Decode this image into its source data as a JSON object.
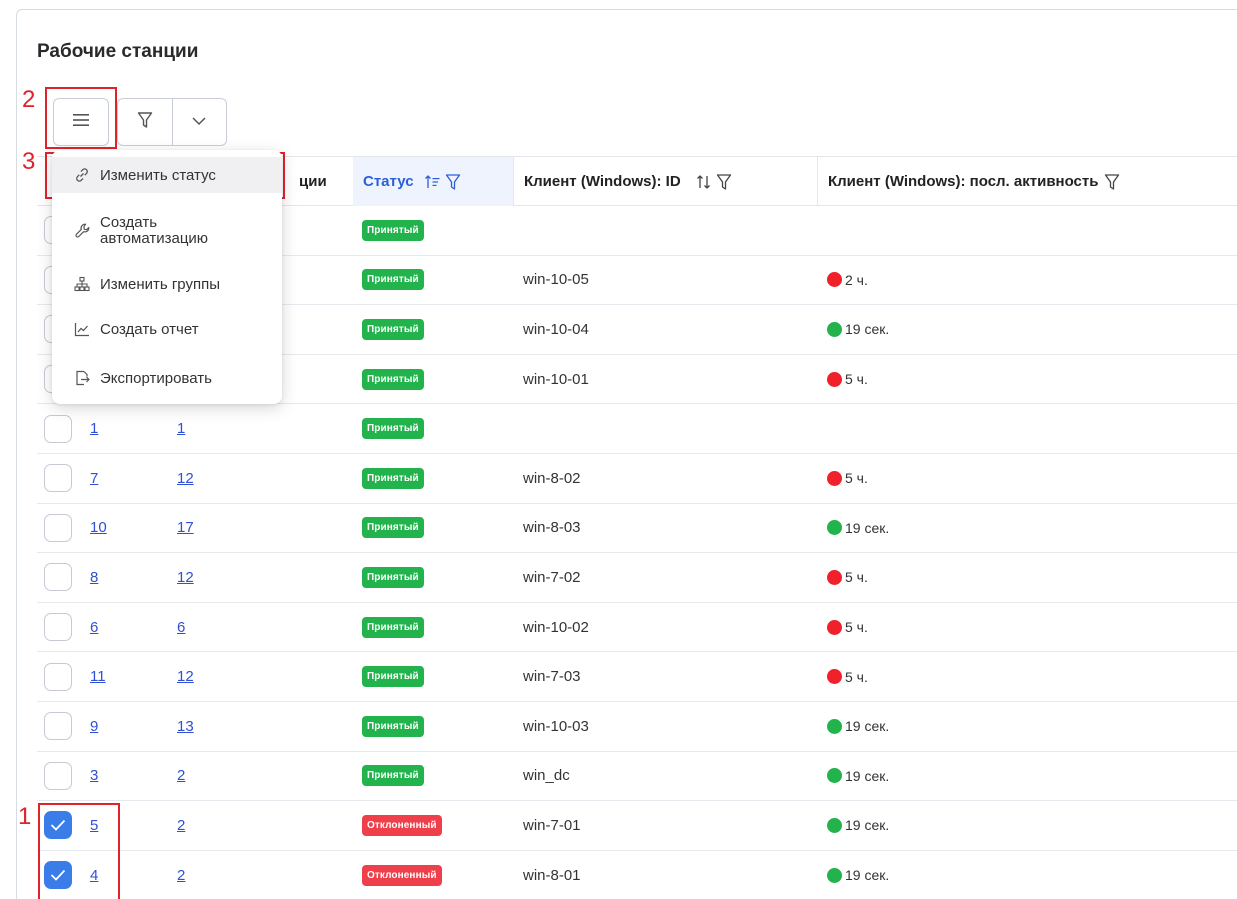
{
  "page": {
    "title": "Рабочие станции"
  },
  "toolbar": {
    "menu_icon": "hamburger-icon",
    "filter_icon": "funnel-icon",
    "dropdown_icon": "chevron-down-icon"
  },
  "columns": {
    "hidden_partial": "ции",
    "status": "Статус",
    "client_id": "Клиент (Windows): ID",
    "client_activity": "Клиент (Windows): посл. активность"
  },
  "menu": {
    "items": [
      {
        "label": "Изменить статус",
        "icon": "link-icon"
      },
      {
        "label": "Создать автоматизацию",
        "line1": "Создать",
        "line2": "автоматизацию",
        "icon": "wrench-icon"
      },
      {
        "label": "Изменить группы",
        "icon": "hierarchy-icon"
      },
      {
        "label": "Создать отчет",
        "icon": "chart-icon"
      },
      {
        "label": "Экспортировать",
        "icon": "export-icon"
      }
    ]
  },
  "rows": [
    {
      "checked": false,
      "a": "",
      "b": "",
      "status": "Принятый",
      "status_kind": "ok",
      "client_id": "",
      "activity": "",
      "dot": ""
    },
    {
      "checked": false,
      "a": "",
      "b": "",
      "status": "Принятый",
      "status_kind": "ok",
      "client_id": "win-10-05",
      "activity": "2 ч.",
      "dot": "red"
    },
    {
      "checked": false,
      "a": "",
      "b": "",
      "status": "Принятый",
      "status_kind": "ok",
      "client_id": "win-10-04",
      "activity": "19 сек.",
      "dot": "green"
    },
    {
      "checked": false,
      "a": "",
      "b": "",
      "status": "Принятый",
      "status_kind": "ok",
      "client_id": "win-10-01",
      "activity": "5 ч.",
      "dot": "red"
    },
    {
      "checked": false,
      "a": "1",
      "b": "1",
      "status": "Принятый",
      "status_kind": "ok",
      "client_id": "",
      "activity": "",
      "dot": ""
    },
    {
      "checked": false,
      "a": "7",
      "b": "12",
      "status": "Принятый",
      "status_kind": "ok",
      "client_id": "win-8-02",
      "activity": "5 ч.",
      "dot": "red"
    },
    {
      "checked": false,
      "a": "10",
      "b": "17",
      "status": "Принятый",
      "status_kind": "ok",
      "client_id": "win-8-03",
      "activity": "19 сек.",
      "dot": "green"
    },
    {
      "checked": false,
      "a": "8",
      "b": "12",
      "status": "Принятый",
      "status_kind": "ok",
      "client_id": "win-7-02",
      "activity": "5 ч.",
      "dot": "red"
    },
    {
      "checked": false,
      "a": "6",
      "b": "6",
      "status": "Принятый",
      "status_kind": "ok",
      "client_id": "win-10-02",
      "activity": "5 ч.",
      "dot": "red"
    },
    {
      "checked": false,
      "a": "11",
      "b": "12",
      "status": "Принятый",
      "status_kind": "ok",
      "client_id": "win-7-03",
      "activity": "5 ч.",
      "dot": "red"
    },
    {
      "checked": false,
      "a": "9",
      "b": "13",
      "status": "Принятый",
      "status_kind": "ok",
      "client_id": "win-10-03",
      "activity": "19 сек.",
      "dot": "green"
    },
    {
      "checked": false,
      "a": "3",
      "b": "2",
      "status": "Принятый",
      "status_kind": "ok",
      "client_id": "win_dc",
      "activity": "19 сек.",
      "dot": "green"
    },
    {
      "checked": true,
      "a": "5",
      "b": "2",
      "status": "Отклоненный",
      "status_kind": "bad",
      "client_id": "win-7-01",
      "activity": "19 сек.",
      "dot": "green"
    },
    {
      "checked": true,
      "a": "4",
      "b": "2",
      "status": "Отклоненный",
      "status_kind": "bad",
      "client_id": "win-8-01",
      "activity": "19 сек.",
      "dot": "green"
    }
  ],
  "annotations": {
    "n1": "1",
    "n2": "2",
    "n3": "3"
  },
  "colors": {
    "accent": "#3b7de8",
    "ok": "#22b34c",
    "bad": "#ee3f4a",
    "annotation": "#e0232b",
    "link": "#2f4fd6"
  }
}
